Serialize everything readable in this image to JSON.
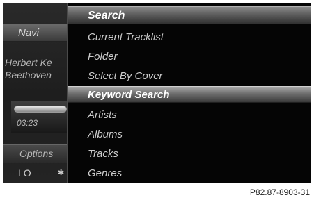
{
  "left": {
    "navi": "Navi",
    "artist": "Herbert Ke",
    "album": "Beethoven",
    "time": "03:23",
    "options": "Options",
    "lo": "LO"
  },
  "menu": {
    "header": "Search",
    "items": [
      {
        "label": "Current Tracklist",
        "selected": false
      },
      {
        "label": "Folder",
        "selected": false
      },
      {
        "label": "Select By Cover",
        "selected": false
      },
      {
        "label": "Keyword Search",
        "selected": true
      },
      {
        "label": "Artists",
        "selected": false
      },
      {
        "label": "Albums",
        "selected": false
      },
      {
        "label": "Tracks",
        "selected": false
      },
      {
        "label": "Genres",
        "selected": false
      }
    ]
  },
  "caption": "P82.87-8903-31"
}
